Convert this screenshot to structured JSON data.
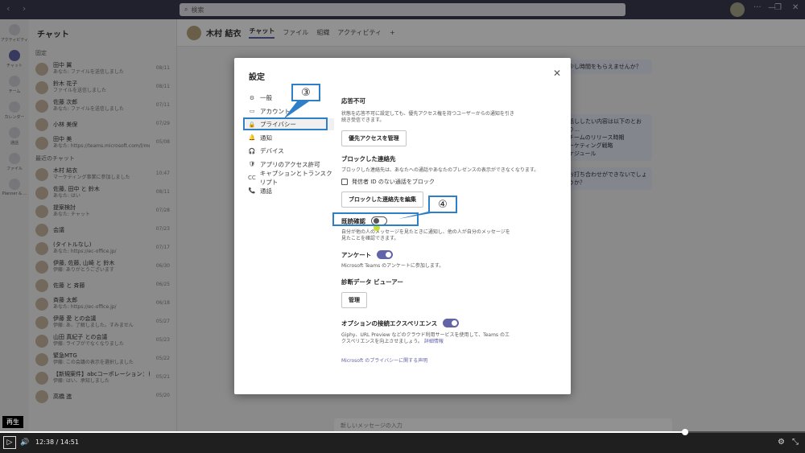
{
  "search": {
    "placeholder": "検索"
  },
  "rail": [
    {
      "label": "アクティビティ",
      "active": false
    },
    {
      "label": "チャット",
      "active": true
    },
    {
      "label": "チーム",
      "active": false
    },
    {
      "label": "カレンダー",
      "active": false
    },
    {
      "label": "通話",
      "active": false
    },
    {
      "label": "ファイル",
      "active": false
    },
    {
      "label": "Planner & ...",
      "active": false
    }
  ],
  "chatlist": {
    "title": "チャット",
    "pinned_label": "固定",
    "recent_label": "最近のチャット",
    "items": [
      {
        "name": "田中 翼",
        "sub": "あなた: ファイルを送信しました",
        "date": "08/11"
      },
      {
        "name": "鈴木 花子",
        "sub": "ファイルを送信しました",
        "date": "08/11"
      },
      {
        "name": "佐藤 次郎",
        "sub": "あなた: ファイルを送信しました",
        "date": "07/11"
      },
      {
        "name": "小林 美保",
        "sub": "",
        "date": "07/29"
      },
      {
        "name": "田中 美",
        "sub": "あなた: https://teams.microsoft.com/l/meetup-joi",
        "date": "05/08"
      },
      {
        "name": "木村 結衣",
        "sub": "マーケティング事業に参加しました",
        "date": "10:47"
      },
      {
        "name": "佐藤, 田中 と 鈴木",
        "sub": "あなた: はい",
        "date": "08/11"
      },
      {
        "name": "提案検討",
        "sub": "あなた: チャット",
        "date": "07/28"
      },
      {
        "name": "会議",
        "sub": "",
        "date": "07/23"
      },
      {
        "name": "(タイトルなし)",
        "sub": "あなた: https://ec-office.jp/",
        "date": "07/17"
      },
      {
        "name": "伊藤, 佐藤, 山崎 と 鈴木",
        "sub": "伊藤: ありがとうございます",
        "date": "06/30"
      },
      {
        "name": "佐藤 と 斉藤",
        "sub": "",
        "date": "06/25"
      },
      {
        "name": "斉藤 太郎",
        "sub": "あなた: https://ec-office.jp/",
        "date": "06/18"
      },
      {
        "name": "伊藤 愛 との会議",
        "sub": "伊藤: あ、了解しました。すみません",
        "date": "05/27"
      },
      {
        "name": "山田 真紀子 との会議",
        "sub": "伊藤: ライブがでなくなりました",
        "date": "05/23"
      },
      {
        "name": "緊急MTG",
        "sub": "伊藤: この会議の表示を選択しました",
        "date": "05/22"
      },
      {
        "name": "【新規案件】abcコーポレーション：ヒアリン...",
        "sub": "伊藤: はい、承知しました",
        "date": "05/21"
      },
      {
        "name": "高橋 進",
        "sub": "",
        "date": "05/20"
      }
    ]
  },
  "chat_header": {
    "name": "木村 結衣",
    "tabs": [
      "チャット",
      "ファイル",
      "組織",
      "アクティビティ"
    ],
    "add": "+"
  },
  "bubbles": [
    "少し時間をもらえませんか？",
    "話ししたい内容は以下のとおり…\nチームのリリース時期\nーケティング戦略\nケジュール",
    "お打ち合わせができないでしょうか？"
  ],
  "composer": {
    "placeholder": "新しいメッセージの入力"
  },
  "settings": {
    "title": "設定",
    "close": "✕",
    "nav": [
      {
        "icon": "⚙",
        "label": "一般",
        "selected": false
      },
      {
        "icon": "▭",
        "label": "アカウント",
        "selected": false
      },
      {
        "icon": "🔒",
        "label": "プライバシー",
        "selected": true
      },
      {
        "icon": "🔔",
        "label": "通知",
        "selected": false
      },
      {
        "icon": "🎧",
        "label": "デバイス",
        "selected": false
      },
      {
        "icon": "🛡",
        "label": "アプリのアクセス許可",
        "selected": false
      },
      {
        "icon": "CC",
        "label": "キャプションとトランスクリプト",
        "selected": false
      },
      {
        "icon": "📞",
        "label": "通話",
        "selected": false
      }
    ],
    "dnd": {
      "heading": "応答不可",
      "desc": "状態を応答不可に設定しても、優先アクセス権を持つユーザーからの通知を引き続き受信できます。",
      "button": "優先アクセスを管理"
    },
    "blocked": {
      "heading": "ブロックした連絡先",
      "desc": "ブロックした連絡先は、あなたへの通話やあなたのプレゼンスの表示ができなくなります。",
      "checkbox": "発信者 ID のない通話をブロック",
      "button": "ブロックした連絡先を編集"
    },
    "read_receipts": {
      "heading": "既読確認",
      "on": false,
      "desc": "自分が他の人のメッセージを見たときに通知し、他の人が自分のメッセージを見たことを確認できます。"
    },
    "survey": {
      "heading": "アンケート",
      "on": true,
      "desc": "Microsoft Teams のアンケートに参加します。"
    },
    "diag": {
      "heading": "診断データ ビューアー",
      "button": "管理"
    },
    "optional": {
      "heading": "オプションの接続エクスペリエンス",
      "on": true,
      "desc": "Giphy、URL Preview などのクラウド利用サービスを使用して、Teams のエクスペリエンスを向上させましょう。",
      "link": "詳細情報"
    },
    "privacy_link": "Microsoft のプライバシーに関する声明"
  },
  "callouts": {
    "three": "③",
    "four": "④"
  },
  "player": {
    "tooltip": "再生",
    "play": "▷",
    "volume": "🔊",
    "current": "12:38",
    "sep": "/",
    "total": "14:51",
    "progress": 0.851,
    "settings": "⚙",
    "fullscreen": "⤡"
  }
}
